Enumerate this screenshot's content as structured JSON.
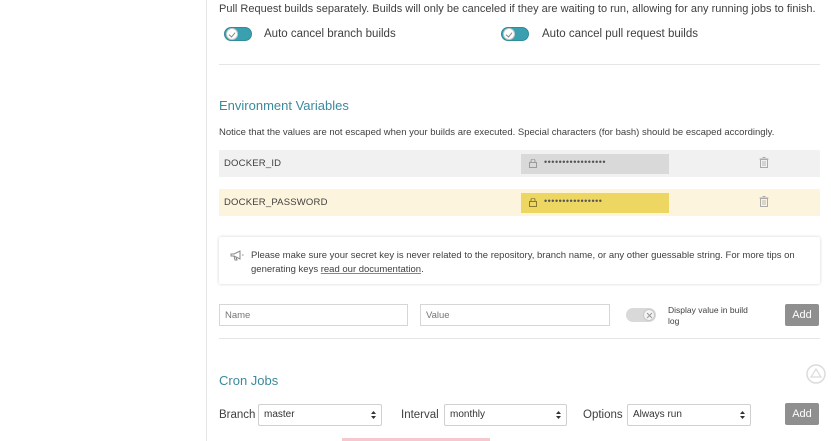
{
  "build_settings": {
    "intro": "Pull Request builds separately. Builds will only be canceled if they are waiting to run, allowing for any running jobs to finish.",
    "auto_cancel_branch": "Auto cancel branch builds",
    "auto_cancel_pr": "Auto cancel pull request builds"
  },
  "env": {
    "title": "Environment Variables",
    "notice": "Notice that the values are not escaped when your builds are executed. Special characters (for bash) should be escaped accordingly.",
    "rows": [
      {
        "name": "DOCKER_ID",
        "value": "•••••••••••••••••"
      },
      {
        "name": "DOCKER_PASSWORD",
        "value": "••••••••••••••••"
      }
    ],
    "tip_text": "Please make sure your secret key is never related to the repository, branch name, or any other guessable string. For more tips on generating keys ",
    "tip_link": "read our documentation",
    "tip_end": ".",
    "name_placeholder": "Name",
    "value_placeholder": "Value",
    "display_label": "Display value in build log",
    "add_label": "Add"
  },
  "cron": {
    "title": "Cron Jobs",
    "branch_label": "Branch",
    "branch_value": "master",
    "interval_label": "Interval",
    "interval_value": "monthly",
    "options_label": "Options",
    "options_value": "Always run",
    "add_label": "Add"
  },
  "colors": {
    "accent": "#3a8a9e",
    "toggle_on": "#3aa0b0",
    "highlight_yellow": "#edd661"
  },
  "icons": [
    "lock-icon",
    "trash-icon",
    "megaphone-icon",
    "select-arrows-icon"
  ]
}
